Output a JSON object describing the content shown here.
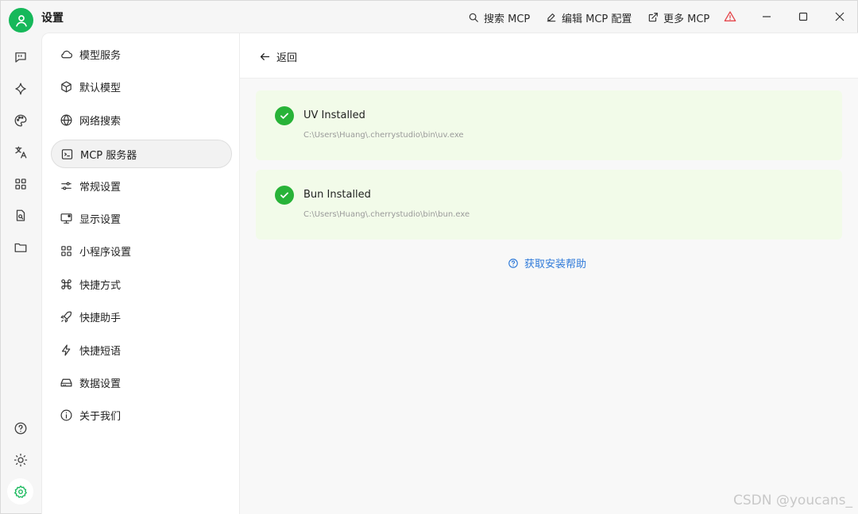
{
  "app": {
    "title": "设置"
  },
  "toolbar": {
    "search_mcp": "搜索 MCP",
    "edit_mcp_config": "编辑 MCP 配置",
    "more_mcp": "更多 MCP"
  },
  "rail": {
    "icons": [
      "chat-icon",
      "sparkle-icon",
      "palette-icon",
      "translate-icon",
      "apps-icon",
      "file-search-icon",
      "folder-icon",
      "help-icon",
      "brightness-icon",
      "settings-icon"
    ]
  },
  "settings_nav": {
    "items": [
      {
        "label": "模型服务",
        "icon": "cloud-icon"
      },
      {
        "label": "默认模型",
        "icon": "cube-icon"
      },
      {
        "label": "网络搜索",
        "icon": "globe-icon"
      },
      {
        "label": "MCP 服务器",
        "icon": "terminal-icon"
      },
      {
        "label": "常规设置",
        "icon": "sliders-icon"
      },
      {
        "label": "显示设置",
        "icon": "monitor-icon"
      },
      {
        "label": "小程序设置",
        "icon": "grid-icon"
      },
      {
        "label": "快捷方式",
        "icon": "command-icon"
      },
      {
        "label": "快捷助手",
        "icon": "rocket-icon"
      },
      {
        "label": "快捷短语",
        "icon": "zap-icon"
      },
      {
        "label": "数据设置",
        "icon": "drive-icon"
      },
      {
        "label": "关于我们",
        "icon": "info-icon"
      }
    ],
    "active_index": 3
  },
  "main": {
    "back_label": "返回",
    "cards": [
      {
        "title": "UV Installed",
        "path": "C:\\Users\\Huang\\.cherrystudio\\bin\\uv.exe"
      },
      {
        "title": "Bun Installed",
        "path": "C:\\Users\\Huang\\.cherrystudio\\bin\\bun.exe"
      }
    ],
    "help_label": "获取安装帮助"
  },
  "watermark": "CSDN @youcans_",
  "colors": {
    "accent_green": "#16b85a",
    "success_green": "#28b338",
    "card_bg": "#f2fbe9",
    "link_blue": "#2f7ad9",
    "warning_red": "#e5484d"
  }
}
